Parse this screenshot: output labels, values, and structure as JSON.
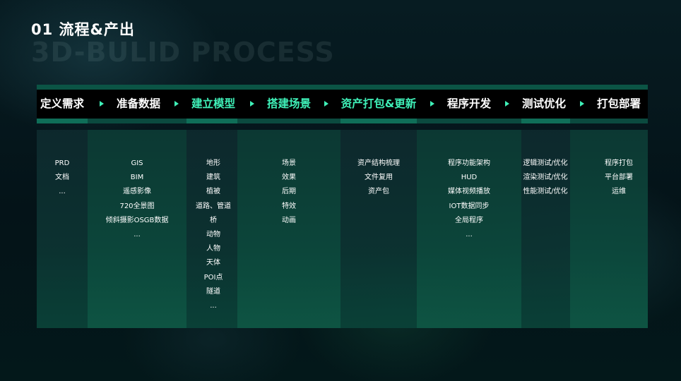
{
  "heading": {
    "title": "01 流程&产出",
    "subtitle": "3D-BULID PROCESS"
  },
  "colors": {
    "accent": "#3ff0b8",
    "bar": "#0b5445",
    "header_bg": "#000000"
  },
  "stages": [
    {
      "title": "定义需求",
      "highlight": false,
      "items": [
        "PRD",
        "文档",
        "..."
      ]
    },
    {
      "title": "准备数据",
      "highlight": false,
      "items": [
        "GIS",
        "BIM",
        "遥感影像",
        "720全景图",
        "倾斜摄影OSGB数据",
        "..."
      ]
    },
    {
      "title": "建立模型",
      "highlight": true,
      "items": [
        "地形",
        "建筑",
        "植被",
        "道路、管道",
        "桥",
        "动物",
        "人物",
        "天体",
        "POI点",
        "隧道",
        "..."
      ]
    },
    {
      "title": "搭建场景",
      "highlight": true,
      "items": [
        "场景",
        "效果",
        "后期",
        "特效",
        "动画"
      ]
    },
    {
      "title": "资产打包&更新",
      "highlight": true,
      "items": [
        "资产结构梳理",
        "文件复用",
        "资产包"
      ]
    },
    {
      "title": "程序开发",
      "highlight": false,
      "items": [
        "程序功能架构",
        "HUD",
        "媒体视频播放",
        "IOT数据同步",
        "全局程序",
        "..."
      ]
    },
    {
      "title": "测试优化",
      "highlight": false,
      "items": [
        "逻辑测试/优化",
        "渲染测试/优化",
        "性能测试/优化"
      ]
    },
    {
      "title": "打包部署",
      "highlight": false,
      "items": [
        "程序打包",
        "平台部署",
        "运维"
      ]
    }
  ]
}
